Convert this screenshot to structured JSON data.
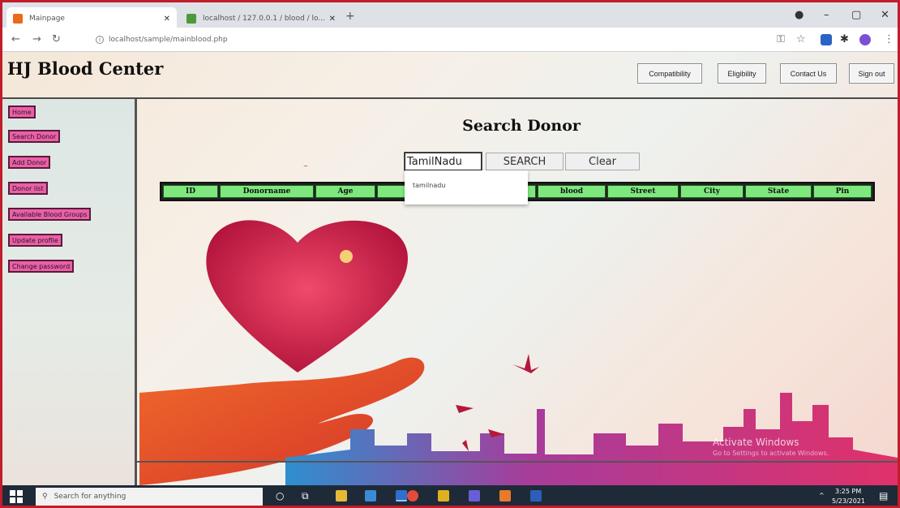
{
  "browser": {
    "active_tab_title": "Mainpage",
    "inactive_tab_title": "localhost / 127.0.0.1 / blood / lo...",
    "url": "localhost/sample/mainblood.php"
  },
  "site": {
    "title": "HJ Blood Center"
  },
  "topnav": [
    {
      "label": "Compatibility"
    },
    {
      "label": "Eligibility"
    },
    {
      "label": "Contact Us"
    },
    {
      "label": "Sign out"
    }
  ],
  "sidebar": {
    "items": [
      {
        "label": "Home"
      },
      {
        "label": "Search Donor"
      },
      {
        "label": "Add Donor"
      },
      {
        "label": "Donor list"
      },
      {
        "label": "Available Blood Groups"
      },
      {
        "label": "Update profile"
      },
      {
        "label": "Change password"
      }
    ]
  },
  "search": {
    "title": "Search Donor",
    "input_value": "TamilNadu",
    "search_label": "SEARCH",
    "clear_label": "Clear",
    "autocomplete": [
      "tamilnadu"
    ]
  },
  "table": {
    "headers": [
      "ID",
      "Donorname",
      "Age",
      "",
      "blood",
      "Street",
      "City",
      "State",
      "Pin"
    ]
  },
  "watermark": {
    "title": "Activate Windows",
    "subtitle": "Go to Settings to activate Windows."
  },
  "taskbar": {
    "search_placeholder": "Search for anything",
    "time": "3:25 PM",
    "date": "5/23/2021"
  },
  "colors": {
    "sidebar_button": "#ec5fa8",
    "table_header": "#7ee87e",
    "border_accent": "#c21d2a"
  }
}
